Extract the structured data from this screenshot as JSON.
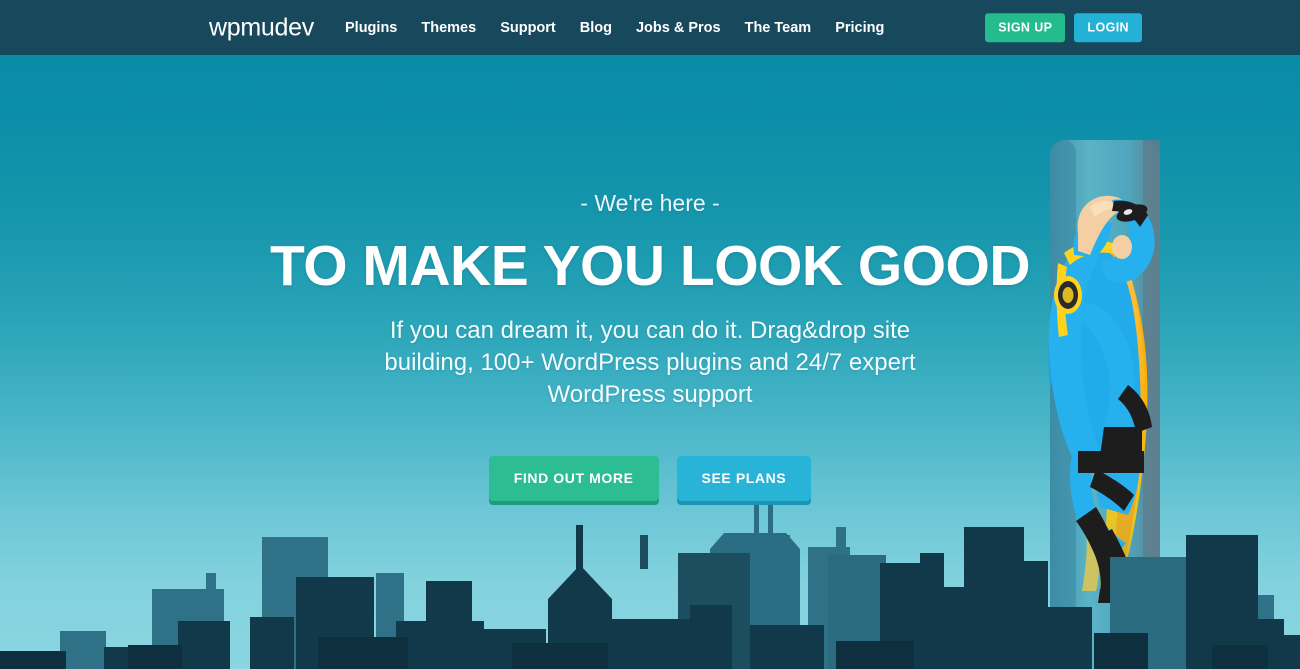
{
  "navbar": {
    "logo": "wpmudev",
    "links": [
      {
        "label": "Plugins"
      },
      {
        "label": "Themes"
      },
      {
        "label": "Support"
      },
      {
        "label": "Blog"
      },
      {
        "label": "Jobs & Pros"
      },
      {
        "label": "The Team"
      },
      {
        "label": "Pricing"
      }
    ],
    "signup_label": "SIGN UP",
    "login_label": "LOGIN",
    "background_color": "#17485c",
    "signup_color": "#24bb8d",
    "login_color": "#23b2d6"
  },
  "hero": {
    "eyebrow": "- We're here -",
    "headline": "TO MAKE YOU LOOK GOOD",
    "subhead": "If you can dream it, you can do it. Drag&drop site building, 100+ WordPress plugins and 24/7 expert WordPress support",
    "primary_cta": "FIND OUT MORE",
    "secondary_cta": "SEE PLANS",
    "primary_cta_color": "#2cbd94",
    "secondary_cta_color": "#28b4d6",
    "sky_top_color": "#0a8ca6",
    "sky_bottom_color": "#8ad5e0",
    "illustration": "flying-superhero-over-city-skyline"
  }
}
